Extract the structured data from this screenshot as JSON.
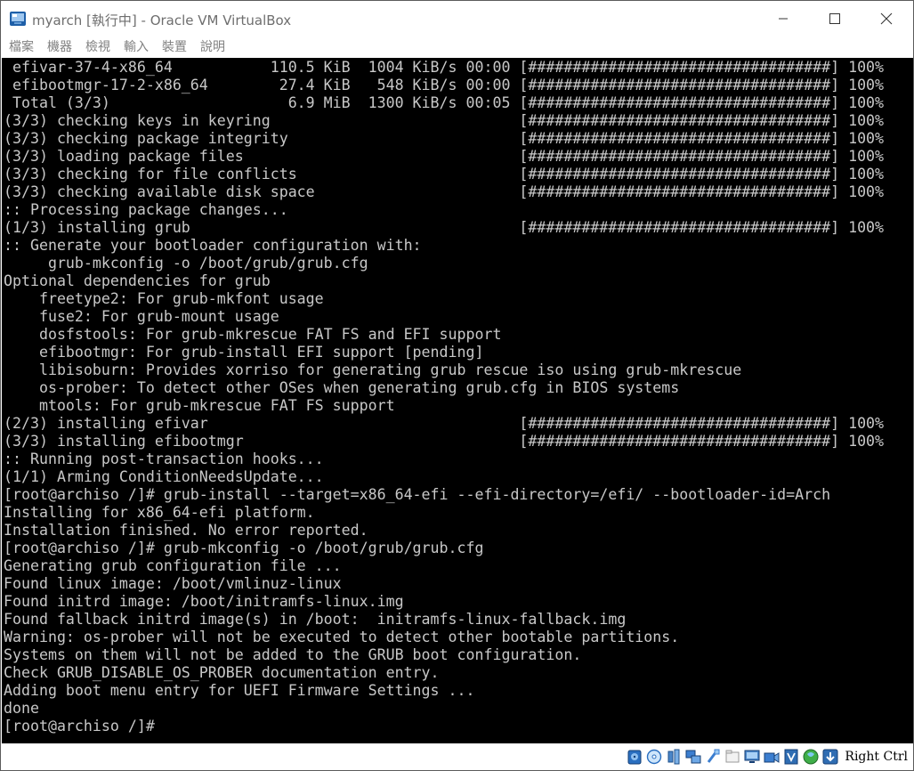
{
  "window": {
    "title": "myarch [執行中] - Oracle VM VirtualBox"
  },
  "menu": {
    "items": [
      "檔案",
      "機器",
      "檢視",
      "輸入",
      "裝置",
      "說明"
    ]
  },
  "console": {
    "lines": [
      " efivar-37-4-x86_64           110.5 KiB  1004 KiB/s 00:00 [##################################] 100%",
      " efibootmgr-17-2-x86_64        27.4 KiB   548 KiB/s 00:00 [##################################] 100%",
      " Total (3/3)                    6.9 MiB  1300 KiB/s 00:05 [##################################] 100%",
      "(3/3) checking keys in keyring                            [##################################] 100%",
      "(3/3) checking package integrity                          [##################################] 100%",
      "(3/3) loading package files                               [##################################] 100%",
      "(3/3) checking for file conflicts                         [##################################] 100%",
      "(3/3) checking available disk space                       [##################################] 100%",
      ":: Processing package changes...",
      "(1/3) installing grub                                     [##################################] 100%",
      ":: Generate your bootloader configuration with:",
      "     grub-mkconfig -o /boot/grub/grub.cfg",
      "Optional dependencies for grub",
      "    freetype2: For grub-mkfont usage",
      "    fuse2: For grub-mount usage",
      "    dosfstools: For grub-mkrescue FAT FS and EFI support",
      "    efibootmgr: For grub-install EFI support [pending]",
      "    libisoburn: Provides xorriso for generating grub rescue iso using grub-mkrescue",
      "    os-prober: To detect other OSes when generating grub.cfg in BIOS systems",
      "    mtools: For grub-mkrescue FAT FS support",
      "(2/3) installing efivar                                   [##################################] 100%",
      "(3/3) installing efibootmgr                               [##################################] 100%",
      ":: Running post-transaction hooks...",
      "(1/1) Arming ConditionNeedsUpdate...",
      "[root@archiso /]# grub-install --target=x86_64-efi --efi-directory=/efi/ --bootloader-id=Arch",
      "Installing for x86_64-efi platform.",
      "Installation finished. No error reported.",
      "[root@archiso /]# grub-mkconfig -o /boot/grub/grub.cfg",
      "Generating grub configuration file ...",
      "Found linux image: /boot/vmlinuz-linux",
      "Found initrd image: /boot/initramfs-linux.img",
      "Found fallback initrd image(s) in /boot:  initramfs-linux-fallback.img",
      "Warning: os-prober will not be executed to detect other bootable partitions.",
      "Systems on them will not be added to the GRUB boot configuration.",
      "Check GRUB_DISABLE_OS_PROBER documentation entry.",
      "Adding boot menu entry for UEFI Firmware Settings ...",
      "done",
      "[root@archiso /]#"
    ]
  },
  "statusbar": {
    "icons": [
      "hard-disk-icon",
      "optical-drive-icon",
      "audio-icon",
      "network-icon",
      "usb-icon",
      "shared-folders-icon",
      "display-icon",
      "recording-icon",
      "virtualization-icon",
      "mouse-integration-icon",
      "keyboard-capture-icon"
    ],
    "host_key": "Right Ctrl"
  },
  "colors": {
    "console_bg": "#000000",
    "console_fg": "#c8c8c8",
    "title_fg": "#6e6e6e",
    "menu_fg": "#808080"
  }
}
